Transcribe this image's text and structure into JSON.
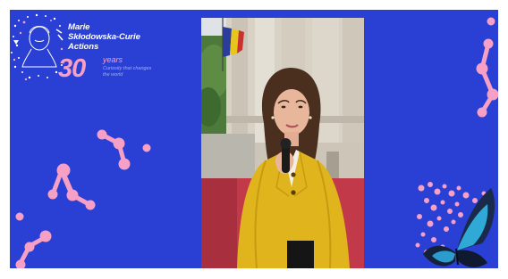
{
  "logo": {
    "line1": "Marie",
    "line2": "Skłodowska-Curie",
    "line3": "Actions",
    "anniversary_number": "30",
    "anniversary_unit": "years",
    "tagline_line1": "Curiosity that changes",
    "tagline_line2": "the world"
  },
  "colors": {
    "background_blue": "#2a3fd3",
    "accent_pink": "#f6a0c6",
    "jacket_yellow": "#e0b41c",
    "carpet_red": "#c23a4a"
  }
}
